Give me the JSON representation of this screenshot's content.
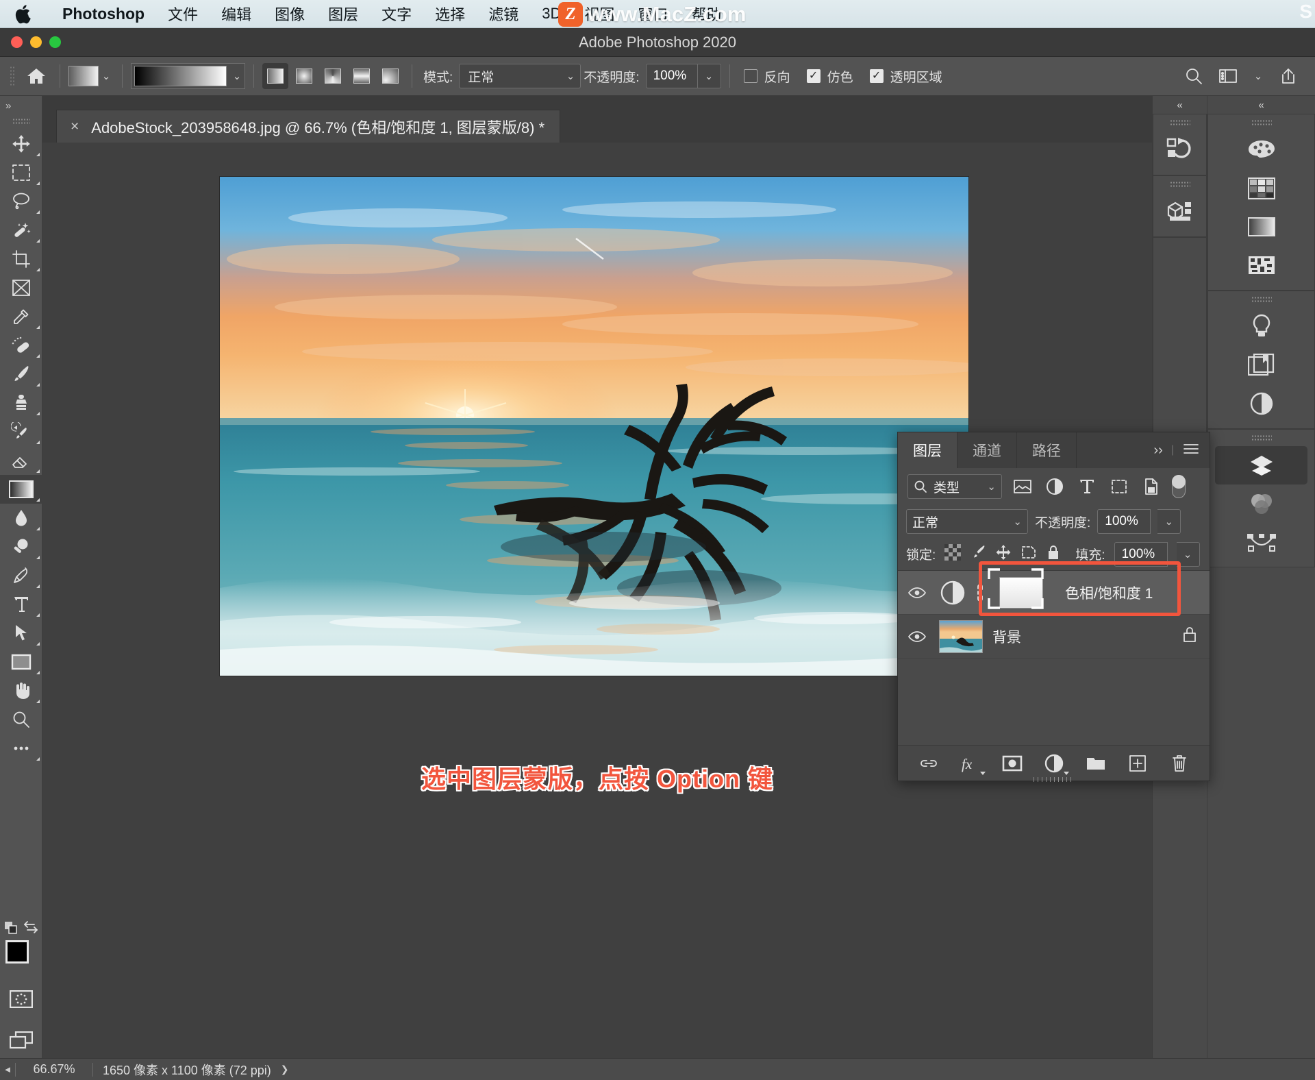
{
  "macmenu": {
    "items": [
      "Photoshop",
      "文件",
      "编辑",
      "图像",
      "图层",
      "文字",
      "选择",
      "滤镜",
      "3D",
      "视图",
      "窗口",
      "帮助"
    ],
    "watermark_badge": "Z",
    "watermark_text": "www.MacZ.com",
    "watermark_right": "S"
  },
  "titlebar": {
    "title": "Adobe Photoshop 2020"
  },
  "optionsbar": {
    "mode_label": "模式:",
    "mode_value": "正常",
    "opacity_label": "不透明度:",
    "opacity_value": "100%",
    "reverse_label": "反向",
    "dither_label": "仿色",
    "transparency_label": "透明区域"
  },
  "document": {
    "tab_title": "AdobeStock_203958648.jpg @ 66.7% (色相/饱和度 1, 图层蒙版/8) *",
    "close_glyph": "×",
    "caption": "选中图层蒙版，点按 Option 键"
  },
  "statusbar": {
    "zoom": "66.67%",
    "dimensions": "1650 像素 x 1100 像素 (72 ppi)",
    "chevron": "❯"
  },
  "layers_panel": {
    "tabs": [
      "图层",
      "通道",
      "路径"
    ],
    "active_tab": "图层",
    "overflow_glyph": "››",
    "filter_value": "类型",
    "blend_mode": "正常",
    "opacity_label": "不透明度:",
    "opacity_value": "100%",
    "lock_label": "锁定:",
    "fill_label": "填充:",
    "fill_value": "100%",
    "layers": [
      {
        "name": "色相/饱和度 1",
        "type": "adjustment",
        "selected": true,
        "locked": false
      },
      {
        "name": "背景",
        "type": "image",
        "selected": false,
        "locked": true
      }
    ]
  },
  "toolbar": {
    "tools": [
      "move-tool",
      "marquee-tool",
      "lasso-tool",
      "magic-wand-tool",
      "crop-tool",
      "frame-tool",
      "eyedropper-tool",
      "healing-brush-tool",
      "brush-tool",
      "clone-stamp-tool",
      "history-brush-tool",
      "eraser-tool",
      "gradient-tool",
      "blur-tool",
      "dodge-tool",
      "pen-tool",
      "type-tool",
      "path-selection-tool",
      "rectangle-tool",
      "hand-tool",
      "zoom-tool",
      "more-tools"
    ],
    "active_tool": "gradient-tool",
    "foreground_color": "#000000",
    "background_color": "#ffffff"
  },
  "right_rail": {
    "icons": [
      "color-palette-icon",
      "swatches-icon",
      "gradients-icon",
      "patterns-icon",
      "adjustments-bulb-icon",
      "libraries-icon",
      "adjustment-layer-icon",
      "layers-icon",
      "channels-icon",
      "paths-icon"
    ],
    "collapsed_icons": [
      "history-icon",
      "3d-icon"
    ],
    "active": "layers-icon"
  },
  "colors": {
    "accent_red": "#f2553d",
    "panel_bg": "#4a4a4a",
    "canvas_bg": "#404040",
    "menu_bg": "#dfeaee"
  }
}
